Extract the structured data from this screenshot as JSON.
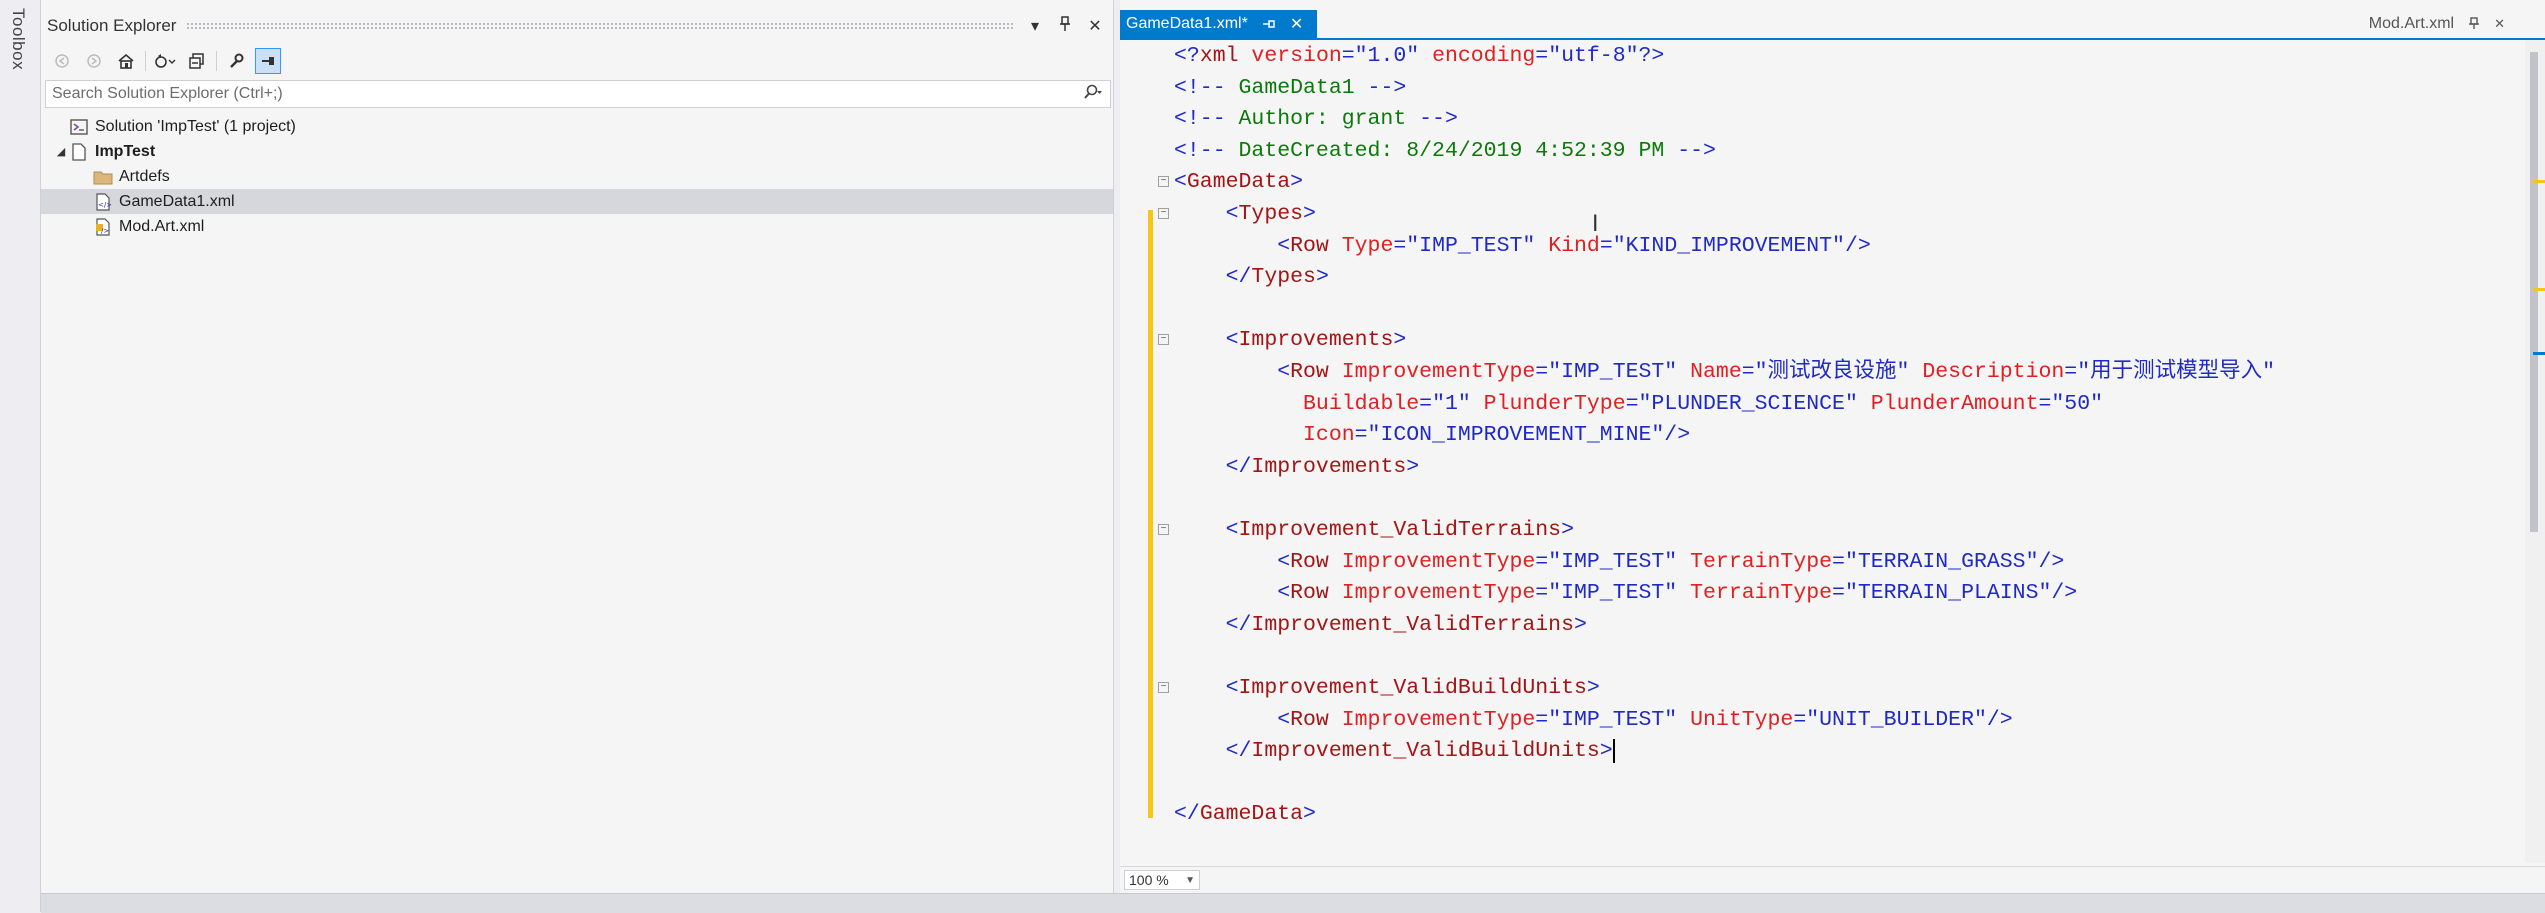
{
  "toolbox": {
    "label": "Toolbox"
  },
  "solution_explorer": {
    "title": "Solution Explorer",
    "title_buttons": [
      "▾",
      "📌",
      "✕"
    ],
    "search": {
      "placeholder": "Search Solution Explorer (Ctrl+;)"
    },
    "tree": [
      {
        "label": "Solution 'ImpTest' (1 project)",
        "icon": "solution-icon",
        "level": 0,
        "bold": false,
        "selected": false,
        "arrow": ""
      },
      {
        "label": "ImpTest",
        "icon": "project-icon",
        "level": 0,
        "bold": true,
        "selected": false,
        "arrow": "◢"
      },
      {
        "label": "Artdefs",
        "icon": "folder-icon",
        "level": 1,
        "bold": false,
        "selected": false,
        "arrow": ""
      },
      {
        "label": "GameData1.xml",
        "icon": "xml-file-icon",
        "level": 1,
        "bold": false,
        "selected": true,
        "arrow": ""
      },
      {
        "label": "Mod.Art.xml",
        "icon": "art-xml-file-icon",
        "level": 1,
        "bold": false,
        "selected": false,
        "arrow": ""
      }
    ]
  },
  "editor": {
    "active_tab": {
      "label": "GameData1.xml*",
      "pin": "⊕",
      "close": "✕"
    },
    "right_tab": {
      "label": "Mod.Art.xml"
    },
    "zoom": "100 %",
    "lines": [
      [
        [
          "t-b",
          "<?"
        ],
        [
          "t-r",
          "xml"
        ],
        [
          "t-a",
          " version"
        ],
        [
          "t-b",
          "="
        ],
        [
          "t-v",
          "\"1.0\""
        ],
        [
          "t-a",
          " encoding"
        ],
        [
          "t-b",
          "="
        ],
        [
          "t-v",
          "\"utf-8\""
        ],
        [
          "t-b",
          "?>"
        ]
      ],
      [
        [
          "t-b",
          "<!--"
        ],
        [
          "t-c",
          " GameData1 "
        ],
        [
          "t-b",
          "-->"
        ]
      ],
      [
        [
          "t-b",
          "<!--"
        ],
        [
          "t-c",
          " Author: grant "
        ],
        [
          "t-b",
          "-->"
        ]
      ],
      [
        [
          "t-b",
          "<!--"
        ],
        [
          "t-c",
          " DateCreated: 8/24/2019 4:52:39 PM "
        ],
        [
          "t-b",
          "-->"
        ]
      ],
      [
        [
          "t-b",
          "<"
        ],
        [
          "t-r",
          "GameData"
        ],
        [
          "t-b",
          ">"
        ]
      ],
      [
        [
          "",
          "    "
        ],
        [
          "t-b",
          "<"
        ],
        [
          "t-r",
          "Types"
        ],
        [
          "t-b",
          ">"
        ]
      ],
      [
        [
          "",
          "        "
        ],
        [
          "t-b",
          "<"
        ],
        [
          "t-r",
          "Row"
        ],
        [
          "t-a",
          " Type"
        ],
        [
          "t-b",
          "="
        ],
        [
          "t-v",
          "\"IMP_TEST\""
        ],
        [
          "t-a",
          " Kind"
        ],
        [
          "t-b",
          "="
        ],
        [
          "t-v",
          "\"KIND_IMPROVEMENT\""
        ],
        [
          "t-b",
          "/>"
        ]
      ],
      [
        [
          "",
          "    "
        ],
        [
          "t-b",
          "</"
        ],
        [
          "t-r",
          "Types"
        ],
        [
          "t-b",
          ">"
        ]
      ],
      [],
      [
        [
          "",
          "    "
        ],
        [
          "t-b",
          "<"
        ],
        [
          "t-r",
          "Improvements"
        ],
        [
          "t-b",
          ">"
        ]
      ],
      [
        [
          "",
          "        "
        ],
        [
          "t-b",
          "<"
        ],
        [
          "t-r",
          "Row"
        ],
        [
          "t-a",
          " ImprovementType"
        ],
        [
          "t-b",
          "="
        ],
        [
          "t-v",
          "\"IMP_TEST\""
        ],
        [
          "t-a",
          " Name"
        ],
        [
          "t-b",
          "="
        ],
        [
          "t-v",
          "\"测试改良设施\""
        ],
        [
          "t-a",
          " Description"
        ],
        [
          "t-b",
          "="
        ],
        [
          "t-v",
          "\"用于测试模型导入\""
        ]
      ],
      [
        [
          "",
          "          "
        ],
        [
          "t-a",
          "Buildable"
        ],
        [
          "t-b",
          "="
        ],
        [
          "t-v",
          "\"1\""
        ],
        [
          "t-a",
          " PlunderType"
        ],
        [
          "t-b",
          "="
        ],
        [
          "t-v",
          "\"PLUNDER_SCIENCE\""
        ],
        [
          "t-a",
          " PlunderAmount"
        ],
        [
          "t-b",
          "="
        ],
        [
          "t-v",
          "\"50\""
        ]
      ],
      [
        [
          "",
          "          "
        ],
        [
          "t-a",
          "Icon"
        ],
        [
          "t-b",
          "="
        ],
        [
          "t-v",
          "\"ICON_IMPROVEMENT_MINE\""
        ],
        [
          "t-b",
          "/>"
        ]
      ],
      [
        [
          "",
          "    "
        ],
        [
          "t-b",
          "</"
        ],
        [
          "t-r",
          "Improvements"
        ],
        [
          "t-b",
          ">"
        ]
      ],
      [],
      [
        [
          "",
          "    "
        ],
        [
          "t-b",
          "<"
        ],
        [
          "t-r",
          "Improvement_ValidTerrains"
        ],
        [
          "t-b",
          ">"
        ]
      ],
      [
        [
          "",
          "        "
        ],
        [
          "t-b",
          "<"
        ],
        [
          "t-r",
          "Row"
        ],
        [
          "t-a",
          " ImprovementType"
        ],
        [
          "t-b",
          "="
        ],
        [
          "t-v",
          "\"IMP_TEST\""
        ],
        [
          "t-a",
          " TerrainType"
        ],
        [
          "t-b",
          "="
        ],
        [
          "t-v",
          "\"TERRAIN_GRASS\""
        ],
        [
          "t-b",
          "/>"
        ]
      ],
      [
        [
          "",
          "        "
        ],
        [
          "t-b",
          "<"
        ],
        [
          "t-r",
          "Row"
        ],
        [
          "t-a",
          " ImprovementType"
        ],
        [
          "t-b",
          "="
        ],
        [
          "t-v",
          "\"IMP_TEST\""
        ],
        [
          "t-a",
          " TerrainType"
        ],
        [
          "t-b",
          "="
        ],
        [
          "t-v",
          "\"TERRAIN_PLAINS\""
        ],
        [
          "t-b",
          "/>"
        ]
      ],
      [
        [
          "",
          "    "
        ],
        [
          "t-b",
          "</"
        ],
        [
          "t-r",
          "Improvement_ValidTerrains"
        ],
        [
          "t-b",
          ">"
        ]
      ],
      [],
      [
        [
          "",
          "    "
        ],
        [
          "t-b",
          "<"
        ],
        [
          "t-r",
          "Improvement_ValidBuildUnits"
        ],
        [
          "t-b",
          ">"
        ]
      ],
      [
        [
          "",
          "        "
        ],
        [
          "t-b",
          "<"
        ],
        [
          "t-r",
          "Row"
        ],
        [
          "t-a",
          " ImprovementType"
        ],
        [
          "t-b",
          "="
        ],
        [
          "t-v",
          "\"IMP_TEST\""
        ],
        [
          "t-a",
          " UnitType"
        ],
        [
          "t-b",
          "="
        ],
        [
          "t-v",
          "\"UNIT_BUILDER\""
        ],
        [
          "t-b",
          "/>"
        ]
      ],
      [
        [
          "",
          "    "
        ],
        [
          "t-b",
          "</"
        ],
        [
          "t-r",
          "Improvement_ValidBuildUnits"
        ],
        [
          "t-b",
          ">"
        ],
        [
          "cursor",
          ""
        ]
      ],
      [],
      [
        [
          "t-b",
          "</"
        ],
        [
          "t-r",
          "GameData"
        ],
        [
          "t-b",
          ">"
        ]
      ]
    ]
  },
  "colors": {
    "accent": "#007acc",
    "change_marker": "#f5c518",
    "selection": "#d6d7dc"
  }
}
